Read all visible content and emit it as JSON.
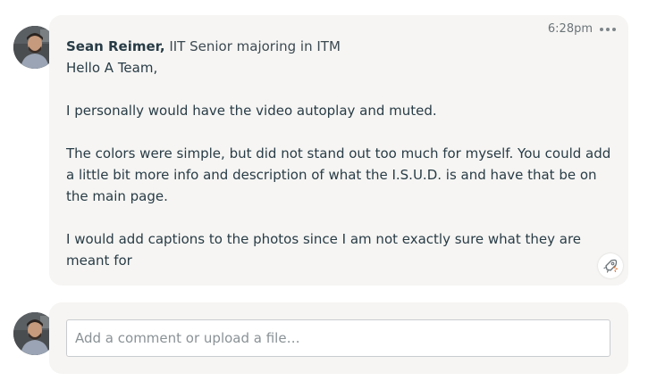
{
  "comment": {
    "author_name": "Sean Reimer,",
    "author_title": " IIT Senior majoring in ITM",
    "time": "6:28pm",
    "paragraphs": [
      "Hello A Team,",
      "I personally would have the video autoplay and muted.",
      "The colors were simple, but did not stand out too much for myself.  You could add a little bit more info and description of what the I.S.U.D. is and have that be on the main page.",
      "I would add captions to the photos since I am not exactly sure what they are meant for"
    ],
    "menu_icon": "more-options-icon",
    "boost_icon": "boost-rocket-icon"
  },
  "composer": {
    "placeholder": "Add a comment or upload a file…"
  },
  "colors": {
    "bubble": "#f6f5f3",
    "text": "#283c46",
    "muted": "#6b7479"
  }
}
